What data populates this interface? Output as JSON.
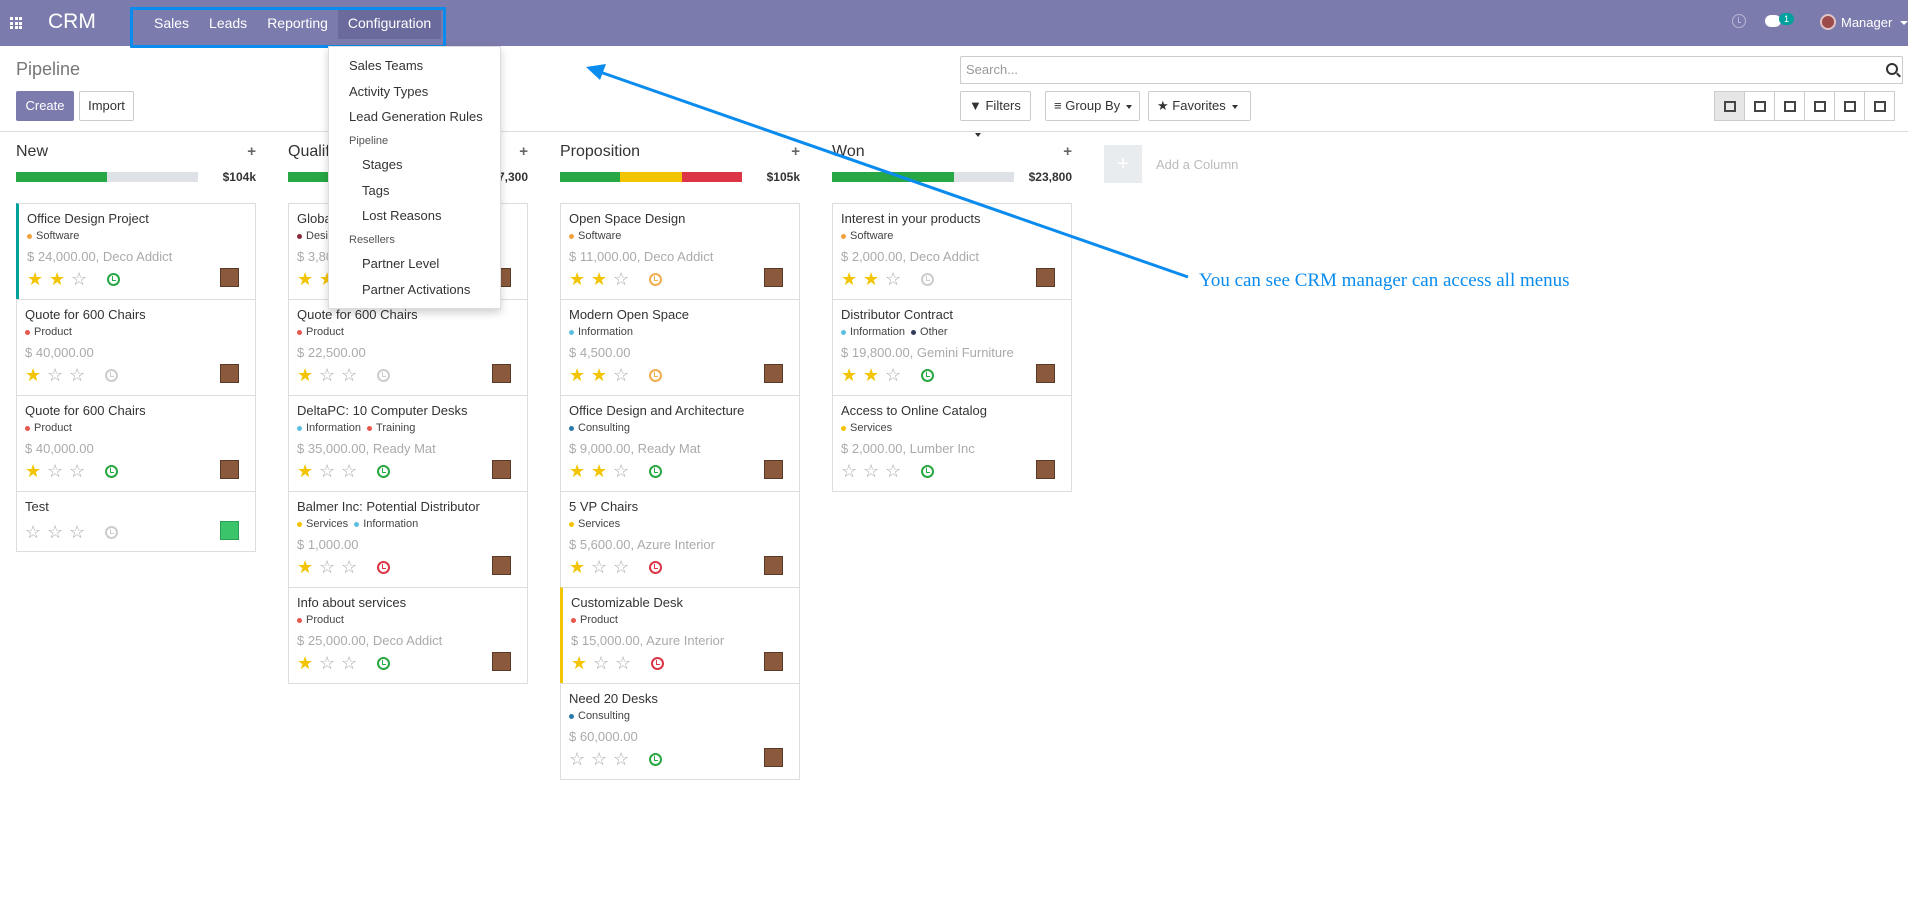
{
  "app": {
    "name": "CRM"
  },
  "nav": {
    "items": [
      "Sales",
      "Leads",
      "Reporting",
      "Configuration"
    ]
  },
  "topbar": {
    "chat_count": "1",
    "user": "Manager"
  },
  "control": {
    "title": "Pipeline",
    "create_label": "Create",
    "import_label": "Import",
    "search_placeholder": "Search...",
    "filters_label": "Filters",
    "groupby_label": "Group By",
    "favorites_label": "Favorites"
  },
  "config_menu": {
    "item_sales_teams": "Sales Teams",
    "item_activity_types": "Activity Types",
    "item_lead_rules": "Lead Generation Rules",
    "header_pipeline": "Pipeline",
    "item_stages": "Stages",
    "item_tags": "Tags",
    "item_lost_reasons": "Lost Reasons",
    "header_resellers": "Resellers",
    "item_partner_level": "Partner Level",
    "item_partner_activations": "Partner Activations"
  },
  "tag_colors": {
    "Software": "#f0a33e",
    "Product": "#e8574c",
    "Design": "#8a2b3a",
    "Information": "#5bc0de",
    "Training": "#e8574c",
    "Services": "#f3c400",
    "Consulting": "#2878a8",
    "Other": "#333b5a"
  },
  "columns": [
    {
      "name": "New",
      "total": "$104k",
      "progress": [
        {
          "color": "#28a745",
          "pct": 50
        }
      ],
      "cards": [
        {
          "title": "Office Design Project",
          "tags": [
            "Software"
          ],
          "amount": "$ 24,000.00, Deco Addict",
          "stars": 2,
          "activity": "green",
          "accent": "#00a09d"
        },
        {
          "title": "Quote for 600 Chairs",
          "tags": [
            "Product"
          ],
          "amount": "$ 40,000.00",
          "stars": 1,
          "activity": "grey"
        },
        {
          "title": "Quote for 600 Chairs",
          "tags": [
            "Product"
          ],
          "amount": "$ 40,000.00",
          "stars": 1,
          "activity": "green"
        },
        {
          "title": "Test",
          "tags": [],
          "amount": "",
          "stars": 0,
          "activity": "grey",
          "face": "green"
        }
      ]
    },
    {
      "name": "Qualified",
      "total": "$77,300",
      "progress": [
        {
          "color": "#28a745",
          "pct": 45
        }
      ],
      "cards": [
        {
          "title": "Global Headquarters",
          "tags": [
            "Design"
          ],
          "amount": "$ 3,800.00",
          "stars": 2,
          "activity": "green"
        },
        {
          "title": "Quote for 600 Chairs",
          "tags": [
            "Product"
          ],
          "amount": "$ 22,500.00",
          "stars": 1,
          "activity": "grey"
        },
        {
          "title": "DeltaPC: 10 Computer Desks",
          "tags": [
            "Information",
            "Training"
          ],
          "amount": "$ 35,000.00, Ready Mat",
          "stars": 1,
          "activity": "green"
        },
        {
          "title": "Balmer Inc: Potential Distributor",
          "tags": [
            "Services",
            "Information"
          ],
          "amount": "$ 1,000.00",
          "stars": 1,
          "activity": "red"
        },
        {
          "title": "Info about services",
          "tags": [
            "Product"
          ],
          "amount": "$ 25,000.00, Deco Addict",
          "stars": 1,
          "activity": "green"
        }
      ]
    },
    {
      "name": "Proposition",
      "total": "$105k",
      "progress": [
        {
          "color": "#28a745",
          "pct": 33
        },
        {
          "color": "#f3c400",
          "pct": 34
        },
        {
          "color": "#dc3545",
          "pct": 33
        }
      ],
      "cards": [
        {
          "title": "Open Space Design",
          "tags": [
            "Software"
          ],
          "amount": "$ 11,000.00, Deco Addict",
          "stars": 2,
          "activity": "orange"
        },
        {
          "title": "Modern Open Space",
          "tags": [
            "Information"
          ],
          "amount": "$ 4,500.00",
          "stars": 2,
          "activity": "orange"
        },
        {
          "title": "Office Design and Architecture",
          "tags": [
            "Consulting"
          ],
          "amount": "$ 9,000.00, Ready Mat",
          "stars": 2,
          "activity": "green"
        },
        {
          "title": "5 VP Chairs",
          "tags": [
            "Services"
          ],
          "amount": "$ 5,600.00, Azure Interior",
          "stars": 1,
          "activity": "red"
        },
        {
          "title": "Customizable Desk",
          "tags": [
            "Product"
          ],
          "amount": "$ 15,000.00, Azure Interior",
          "stars": 1,
          "activity": "red",
          "accent": "#f3c400"
        },
        {
          "title": "Need 20 Desks",
          "tags": [
            "Consulting"
          ],
          "amount": "$ 60,000.00",
          "stars": 0,
          "activity": "green"
        }
      ]
    },
    {
      "name": "Won",
      "total": "$23,800",
      "progress": [
        {
          "color": "#28a745",
          "pct": 67
        }
      ],
      "cards": [
        {
          "title": "Interest in your products",
          "tags": [
            "Software"
          ],
          "amount": "$ 2,000.00, Deco Addict",
          "stars": 2,
          "activity": "grey"
        },
        {
          "title": "Distributor Contract",
          "tags": [
            "Information",
            "Other"
          ],
          "amount": "$ 19,800.00, Gemini Furniture",
          "stars": 2,
          "activity": "green"
        },
        {
          "title": "Access to Online Catalog",
          "tags": [
            "Services"
          ],
          "amount": "$ 2,000.00, Lumber Inc",
          "stars": 0,
          "activity": "green"
        }
      ]
    }
  ],
  "add_column_label": "Add a Column",
  "annotation": {
    "text": "You can see CRM manager can access all menus"
  }
}
